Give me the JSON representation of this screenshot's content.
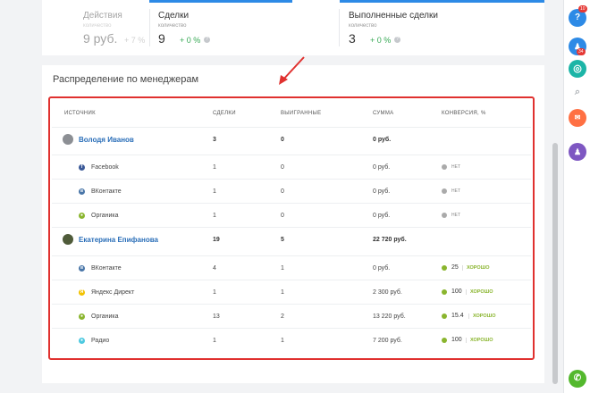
{
  "top_stats": [
    {
      "title": "Действия",
      "sub": "количество",
      "value": "9 руб.",
      "delta": "+ 7 %"
    },
    {
      "title": "Сделки",
      "sub": "количество",
      "value": "9",
      "delta": "+ 0 %"
    },
    {
      "title": "Выполненные сделки",
      "sub": "количество",
      "value": "3",
      "delta": "+ 0 %"
    }
  ],
  "section": {
    "title": "Распределение по менеджерам"
  },
  "table": {
    "headers": [
      "ИСТОЧНИК",
      "СДЕЛКИ",
      "ВЫИГРАННЫЕ",
      "СУММА",
      "КОНВЕРСИЯ, %"
    ],
    "managers": [
      {
        "name": "Володя Иванов",
        "deals": "3",
        "won": "0",
        "sum": "0 руб.",
        "sources": [
          {
            "name": "Facebook",
            "icon": "facebook-icon",
            "deals": "1",
            "won": "0",
            "sum": "0 руб.",
            "conv_num": "",
            "conv_label": "НЕТ",
            "dot": "#aaaaaa"
          },
          {
            "name": "ВКонтакте",
            "icon": "vk-icon",
            "deals": "1",
            "won": "0",
            "sum": "0 руб.",
            "conv_num": "",
            "conv_label": "НЕТ",
            "dot": "#aaaaaa"
          },
          {
            "name": "Органика",
            "icon": "organic-icon",
            "deals": "1",
            "won": "0",
            "sum": "0 руб.",
            "conv_num": "",
            "conv_label": "НЕТ",
            "dot": "#aaaaaa"
          }
        ]
      },
      {
        "name": "Екатерина Епифанова",
        "deals": "19",
        "won": "5",
        "sum": "22 720 руб.",
        "sources": [
          {
            "name": "ВКонтакте",
            "icon": "vk-icon",
            "deals": "4",
            "won": "1",
            "sum": "0 руб.",
            "conv_num": "25",
            "conv_label": "ХОРОШО",
            "dot": "#8ab52e"
          },
          {
            "name": "Яндекс Директ",
            "icon": "yandex-icon",
            "deals": "1",
            "won": "1",
            "sum": "2 300 руб.",
            "conv_num": "100",
            "conv_label": "ХОРОШО",
            "dot": "#8ab52e"
          },
          {
            "name": "Органика",
            "icon": "organic-icon",
            "deals": "13",
            "won": "2",
            "sum": "13 220 руб.",
            "conv_num": "15.4",
            "conv_label": "ХОРОШО",
            "dot": "#8ab52e"
          },
          {
            "name": "Радио",
            "icon": "radio-icon",
            "deals": "1",
            "won": "1",
            "sum": "7 200 руб.",
            "conv_num": "100",
            "conv_label": "ХОРОШО",
            "dot": "#8ab52e"
          }
        ]
      }
    ]
  },
  "right_panel": {
    "help_badge": "10",
    "contacts_badge": "34",
    "help_label": "?"
  },
  "colors": {
    "accent": "#2d8ae6",
    "highlight": "#e0312f",
    "good": "#8ab52e",
    "positive": "#35a853"
  }
}
